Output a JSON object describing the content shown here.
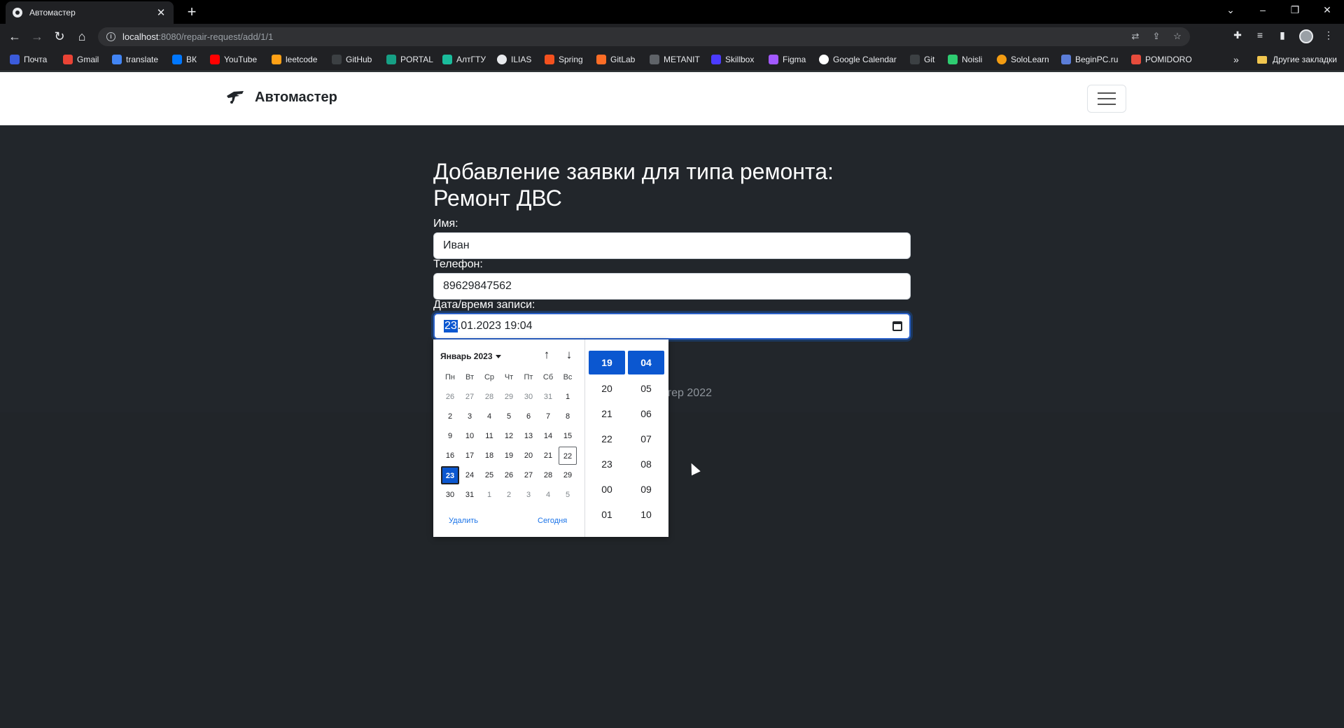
{
  "browser": {
    "tab_title": "Автомастер",
    "tab_close": "✕",
    "new_tab": "+",
    "url_host": "localhost",
    "url_rest": ":8080/repair-request/add/1/1",
    "window_controls": {
      "dropdown": "⌄",
      "minimize": "–",
      "restore": "❐",
      "close": "✕"
    }
  },
  "bookmarks": {
    "items": [
      {
        "label": "Почта",
        "icon_color": "#3b5bdb"
      },
      {
        "label": "Gmail",
        "icon_color": "#ea4335"
      },
      {
        "label": "translate",
        "icon_color": "#4285f4"
      },
      {
        "label": "ВК",
        "icon_color": "#0077ff"
      },
      {
        "label": "YouTube",
        "icon_color": "#ff0000"
      },
      {
        "label": "leetcode",
        "icon_color": "#ffa116"
      },
      {
        "label": "GitHub",
        "icon_color": "#3c4043"
      },
      {
        "label": "PORTAL",
        "icon_color": "#16a085"
      },
      {
        "label": "АлтГТУ",
        "icon_color": "#1abc9c"
      },
      {
        "label": "ILIAS",
        "icon_color": "#e8eaed"
      },
      {
        "label": "Spring",
        "icon_color": "#f4511e"
      },
      {
        "label": "GitLab",
        "icon_color": "#fc6d26"
      },
      {
        "label": "METANIT",
        "icon_color": "#5f6368"
      },
      {
        "label": "Skillbox",
        "icon_color": "#4b3bff"
      },
      {
        "label": "Figma",
        "icon_color": "#a259ff"
      },
      {
        "label": "Google Calendar",
        "icon_color": "#ffffff"
      },
      {
        "label": "Git",
        "icon_color": "#3c4043"
      },
      {
        "label": "Noisli",
        "icon_color": "#2ecc71"
      },
      {
        "label": "SoloLearn",
        "icon_color": "#f39c12"
      },
      {
        "label": "BeginPC.ru",
        "icon_color": "#5b7dd8"
      },
      {
        "label": "POMIDORO",
        "icon_color": "#e74c3c"
      }
    ],
    "more": "»",
    "other": "Другие закладки"
  },
  "navbar": {
    "brand": "Автомастер",
    "menu_toggle": "menu"
  },
  "form": {
    "heading_line1": "Добавление заявки для типа ремонта:",
    "heading_line2": "Ремонт ДВС",
    "name_label": "Имя:",
    "name_value": "Иван",
    "phone_label": "Телефон:",
    "phone_value": "89629847562",
    "datetime_label": "Дата/время записи:",
    "datetime_day": "23",
    "datetime_rest": ".01.2023 19:04"
  },
  "footer": {
    "text": "стер 2022"
  },
  "datepicker": {
    "month_label": "Январь 2023",
    "weekdays": [
      "Пн",
      "Вт",
      "Ср",
      "Чт",
      "Пт",
      "Сб",
      "Вс"
    ],
    "weeks": [
      [
        "26",
        "27",
        "28",
        "29",
        "30",
        "31",
        "1"
      ],
      [
        "2",
        "3",
        "4",
        "5",
        "6",
        "7",
        "8"
      ],
      [
        "9",
        "10",
        "11",
        "12",
        "13",
        "14",
        "15"
      ],
      [
        "16",
        "17",
        "18",
        "19",
        "20",
        "21",
        "22"
      ],
      [
        "23",
        "24",
        "25",
        "26",
        "27",
        "28",
        "29"
      ],
      [
        "30",
        "31",
        "1",
        "2",
        "3",
        "4",
        "5"
      ]
    ],
    "selected_day": "23",
    "today_day": "22",
    "delete_label": "Удалить",
    "today_label": "Сегодня",
    "hours": [
      "19",
      "20",
      "21",
      "22",
      "23",
      "00",
      "01"
    ],
    "minutes": [
      "04",
      "05",
      "06",
      "07",
      "08",
      "09",
      "10"
    ],
    "selected_hour": "19",
    "selected_minute": "04",
    "accent_color": "#0b57d0"
  }
}
